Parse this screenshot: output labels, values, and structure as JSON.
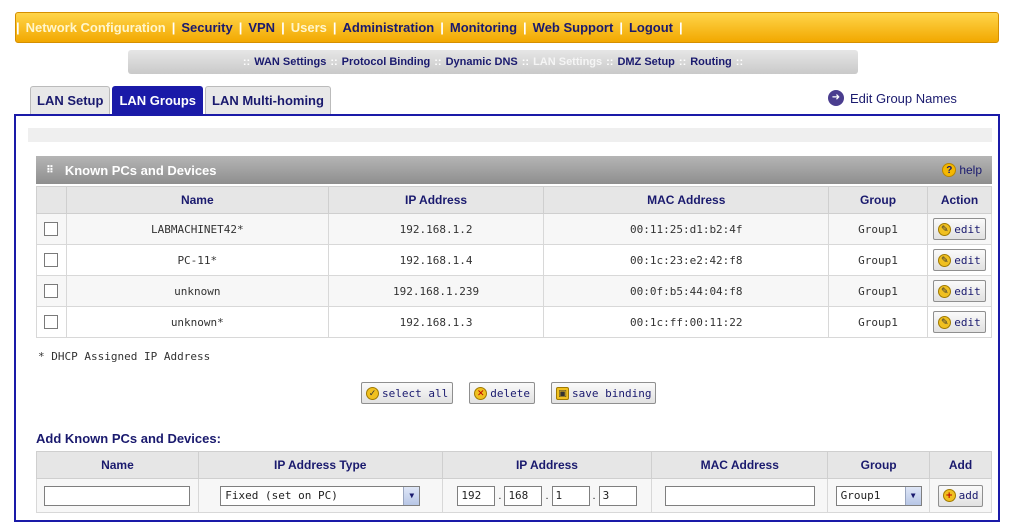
{
  "main_nav": [
    {
      "label": "Network Configuration",
      "dim": true
    },
    {
      "label": "Security",
      "dim": false
    },
    {
      "label": "VPN",
      "dim": false
    },
    {
      "label": "Users",
      "dim": true
    },
    {
      "label": "Administration",
      "dim": false
    },
    {
      "label": "Monitoring",
      "dim": false
    },
    {
      "label": "Web Support",
      "dim": false
    },
    {
      "label": "Logout",
      "dim": false
    }
  ],
  "sub_nav": [
    {
      "label": "WAN Settings",
      "active": false
    },
    {
      "label": "Protocol Binding",
      "active": false
    },
    {
      "label": "Dynamic DNS",
      "active": false
    },
    {
      "label": "LAN Settings",
      "active": true
    },
    {
      "label": "DMZ Setup",
      "active": false
    },
    {
      "label": "Routing",
      "active": false
    }
  ],
  "tabs": [
    {
      "label": "LAN Setup",
      "active": false
    },
    {
      "label": "LAN Groups",
      "active": true
    },
    {
      "label": "LAN Multi-homing",
      "active": false
    }
  ],
  "edit_group_names": "Edit Group Names",
  "known_section": {
    "title": "Known PCs and Devices",
    "help": "help",
    "columns": [
      "Name",
      "IP Address",
      "MAC Address",
      "Group",
      "Action"
    ],
    "rows": [
      {
        "name": "LABMACHINET42*",
        "ip": "192.168.1.2",
        "mac": "00:11:25:d1:b2:4f",
        "group": "Group1",
        "action": "edit"
      },
      {
        "name": "PC-11*",
        "ip": "192.168.1.4",
        "mac": "00:1c:23:e2:42:f8",
        "group": "Group1",
        "action": "edit"
      },
      {
        "name": "unknown",
        "ip": "192.168.1.239",
        "mac": "00:0f:b5:44:04:f8",
        "group": "Group1",
        "action": "edit"
      },
      {
        "name": "unknown*",
        "ip": "192.168.1.3",
        "mac": "00:1c:ff:00:11:22",
        "group": "Group1",
        "action": "edit"
      }
    ],
    "note": "* DHCP Assigned IP Address"
  },
  "buttons": {
    "select_all": "select all",
    "delete": "delete",
    "save_binding": "save binding"
  },
  "add_section": {
    "title": "Add Known PCs and Devices:",
    "columns": [
      "Name",
      "IP Address Type",
      "IP Address",
      "MAC Address",
      "Group",
      "Add"
    ],
    "name_value": "",
    "ip_type": "Fixed (set on PC)",
    "ip_octets": [
      "192",
      "168",
      "1",
      "3"
    ],
    "mac_value": "",
    "group": "Group1",
    "add_label": "add"
  }
}
